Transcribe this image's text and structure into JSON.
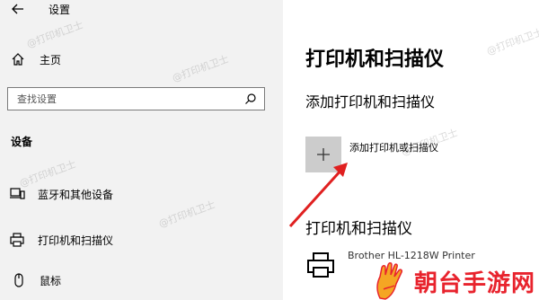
{
  "sidebar": {
    "title": "设置",
    "home_label": "主页",
    "search_placeholder": "查找设置",
    "section_label": "设备",
    "items": [
      {
        "label": "蓝牙和其他设备",
        "icon": "bluetooth-devices-icon"
      },
      {
        "label": "打印机和扫描仪",
        "icon": "printer-icon"
      },
      {
        "label": "鼠标",
        "icon": "mouse-icon"
      }
    ]
  },
  "main": {
    "title": "打印机和扫描仪",
    "add_heading": "添加打印机和扫描仪",
    "add_label": "添加打印机或扫描仪",
    "list_heading": "打印机和扫描仪",
    "device_name": "Brother HL-1218W Printer"
  },
  "watermark_text": "@打印机卫士",
  "brand_text": "朝台手游网",
  "colors": {
    "sidebar_bg": "#f2f2f2",
    "add_button_bg": "#cccccc",
    "arrow": "#e02020",
    "brand": "#e8232d"
  }
}
